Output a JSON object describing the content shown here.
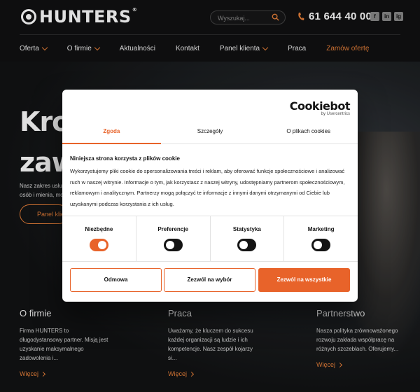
{
  "header": {
    "logo_text": "HUNTERS",
    "logo_reg": "®",
    "search_placeholder": "Wyszukaj...",
    "phone": "61 644 40 00",
    "socials": [
      "f",
      "in",
      "ig"
    ]
  },
  "nav": {
    "items": [
      {
        "label": "Oferta",
        "dropdown": true
      },
      {
        "label": "O firmie",
        "dropdown": true
      },
      {
        "label": "Aktualności",
        "dropdown": false
      },
      {
        "label": "Kontakt",
        "dropdown": false
      },
      {
        "label": "Panel klienta",
        "dropdown": true
      },
      {
        "label": "Praca",
        "dropdown": false
      },
      {
        "label": "Zamów ofertę",
        "dropdown": false,
        "accent": true
      }
    ]
  },
  "hero": {
    "title_line1": "Krok",
    "title_line2": "zaws",
    "sub_line1": "Nasz zakres usług o",
    "sub_line2": "osób i mienia, moni",
    "button": "Panel klienta"
  },
  "columns": [
    {
      "title": "O firmie",
      "text": "Firma HUNTERS to długodystansowy partner. Misją jest uzyskanie maksymalnego zadowolenia i...",
      "more": "Więcej"
    },
    {
      "title": "Praca",
      "text": "Uważamy, że kluczem do sukcesu każdej organizacji są ludzie i ich kompetencje. Nasz zespół kojarzy si...",
      "more": "Więcej"
    },
    {
      "title": "Partnerstwo",
      "text": "Nasza polityka zrównoważonego rozwoju zakłada współpracę na różnych szczeblach. Oferujemy...",
      "more": "Więcej"
    }
  ],
  "cookie": {
    "brand": "Cookiebot",
    "brand_by": "by Usercentrics",
    "tabs": [
      "Zgoda",
      "Szczegóły",
      "O plikach cookies"
    ],
    "heading": "Niniejsza strona korzysta z plików cookie",
    "body": "Wykorzystujemy pliki cookie do spersonalizowania treści i reklam, aby oferować funkcje społecznościowe i analizować ruch w naszej witrynie. Informacje o tym, jak korzystasz z naszej witryny, udostępniamy partnerom społecznościowym, reklamowym i analitycznym. Partnerzy mogą połączyć te informacje z innymi danymi otrzymanymi od Ciebie lub uzyskanymi podczas korzystania z ich usług.",
    "toggles": [
      {
        "label": "Niezbędne",
        "on": true
      },
      {
        "label": "Preferencje",
        "on": false
      },
      {
        "label": "Statystyka",
        "on": false
      },
      {
        "label": "Marketing",
        "on": false
      }
    ],
    "btn_deny": "Odmowa",
    "btn_select": "Zezwól na wybór",
    "btn_all": "Zezwól na wszystkie"
  },
  "colors": {
    "accent": "#e8632a",
    "nav_accent": "#e8803a"
  }
}
